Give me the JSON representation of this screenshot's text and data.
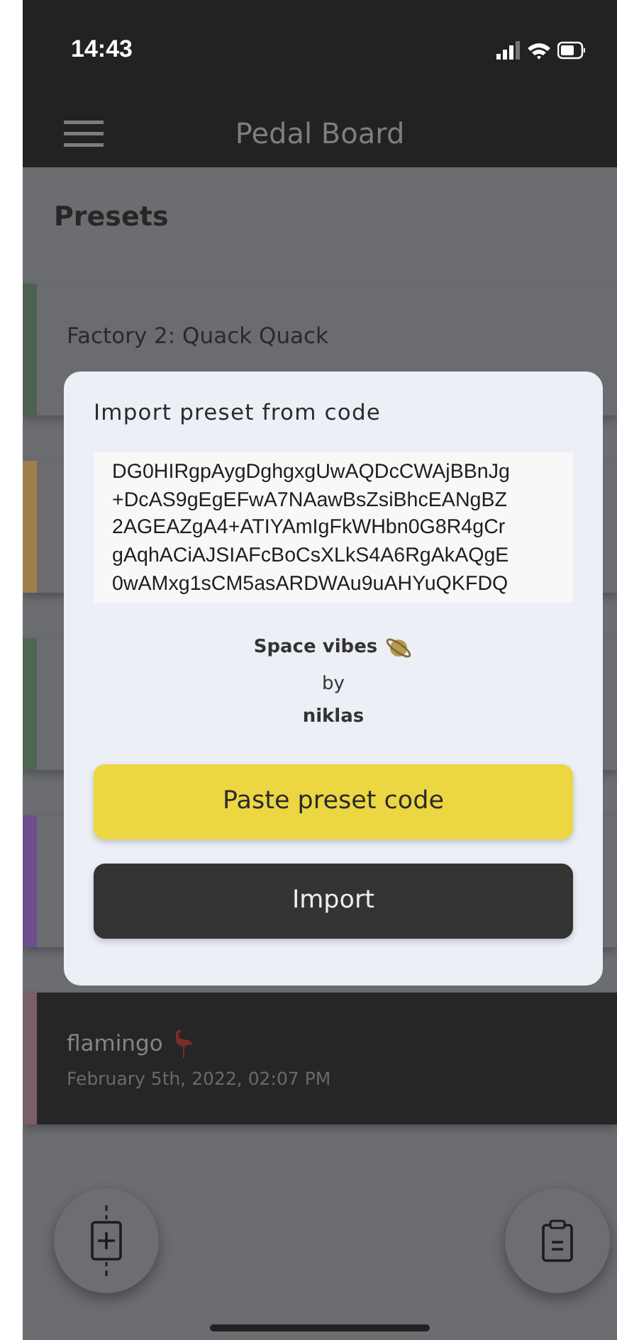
{
  "status_bar": {
    "time": "14:43"
  },
  "app_bar": {
    "title": "Pedal Board"
  },
  "section_title": "Presets",
  "presets": [
    {
      "name": "Factory 2: Quack Quack",
      "color": "#4d6150",
      "selected": false
    },
    {
      "color": "#a07f4c",
      "selected": false
    },
    {
      "color": "#4f6651",
      "selected": false
    },
    {
      "color": "#6c4f8a",
      "selected": false
    },
    {
      "name": "flamingo",
      "date": "February 5th, 2022, 02:07 PM",
      "color": "#7a5e6a",
      "selected": true
    }
  ],
  "dialog": {
    "title": "Import preset from code",
    "code_lines": [
      "DG0HIRgpAygDghgxgUwAQDcCWAjBBnJg",
      "+DcAS9gEgEFwA7NAawBsZsiBhcEANgBZ",
      "2AGEAZgA4+ATIYAmIgFkWHbn0G8R4gCr",
      "gAqhACiAJSIAFcBoCsXLkS4A6RgAkAQgE",
      "0wAMxg1sCM5asARDWAu9uAHYuQKFDQ"
    ],
    "preset_name": "Space vibes",
    "by": "by",
    "author": "niklas",
    "buttons": [
      {
        "label": "Paste preset code",
        "kind": "primary"
      },
      {
        "label": "Import",
        "kind": "dark"
      }
    ]
  }
}
